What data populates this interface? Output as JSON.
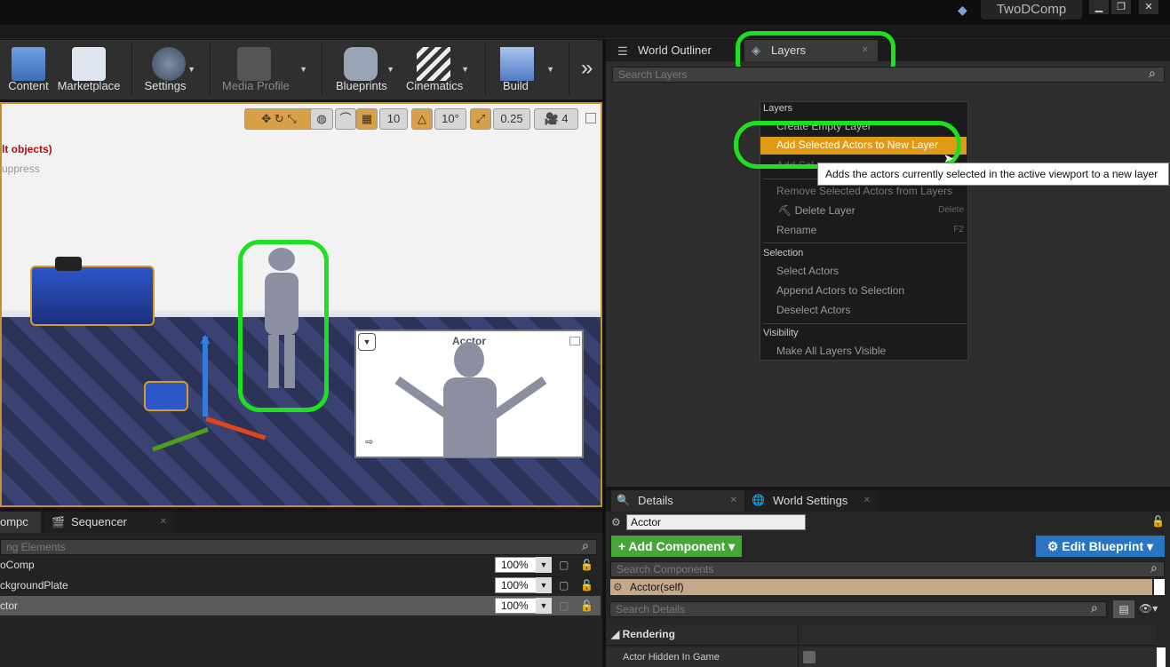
{
  "window": {
    "project_name": "TwoDComp",
    "min": "▁",
    "max": "❐",
    "close": "✕"
  },
  "toolbar": {
    "content": "Content",
    "marketplace": "Marketplace",
    "settings": "Settings",
    "media_profile": "Media Profile",
    "blueprints": "Blueprints",
    "cinematics": "Cinematics",
    "build": "Build",
    "more": "»"
  },
  "viewport": {
    "grid_snap": "10",
    "rotation_snap": "10°",
    "scale_snap": "0.25",
    "camera_speed": "4",
    "warning_line1": "lt objects)",
    "warning_line2": "uppress",
    "pip_title": "Acctor"
  },
  "right_tabs": {
    "outliner": "World Outliner",
    "layers": "Layers"
  },
  "layers_search_placeholder": "Search Layers",
  "context_menu": {
    "section_layers": "Layers",
    "create_empty": "Create Empty Layer",
    "add_selected_new": "Add Selected Actors to New Layer",
    "add_selected": "Add Sel",
    "remove_selected": "Remove Selected Actors from Layers",
    "delete_layer": "Delete Layer",
    "delete_key": "Delete",
    "rename": "Rename",
    "rename_key": "F2",
    "section_selection": "Selection",
    "select_actors": "Select Actors",
    "append_actors": "Append Actors to Selection",
    "deselect_actors": "Deselect Actors",
    "section_visibility": "Visibility",
    "make_all_visible": "Make All Layers Visible"
  },
  "tooltip": "Adds the actors currently selected in the active viewport to a new layer",
  "bottom_left": {
    "tab_comp": "ompc",
    "tab_sequencer": "Sequencer",
    "search_placeholder": "ng Elements",
    "rows": [
      {
        "name": "oComp",
        "pct": "100%"
      },
      {
        "name": "ckgroundPlate",
        "pct": "100%"
      },
      {
        "name": "ctor",
        "pct": "100%"
      }
    ]
  },
  "details": {
    "tab_details": "Details",
    "tab_world_settings": "World Settings",
    "actor_name": "Acctor",
    "add_component": "+ Add Component ▾",
    "edit_blueprint": "⚙ Edit Blueprint ▾",
    "search_components": "Search Components",
    "component_self": "Acctor(self)",
    "search_details": "Search Details",
    "rendering": "◢ Rendering",
    "hidden_in_game": "Actor Hidden In Game"
  }
}
